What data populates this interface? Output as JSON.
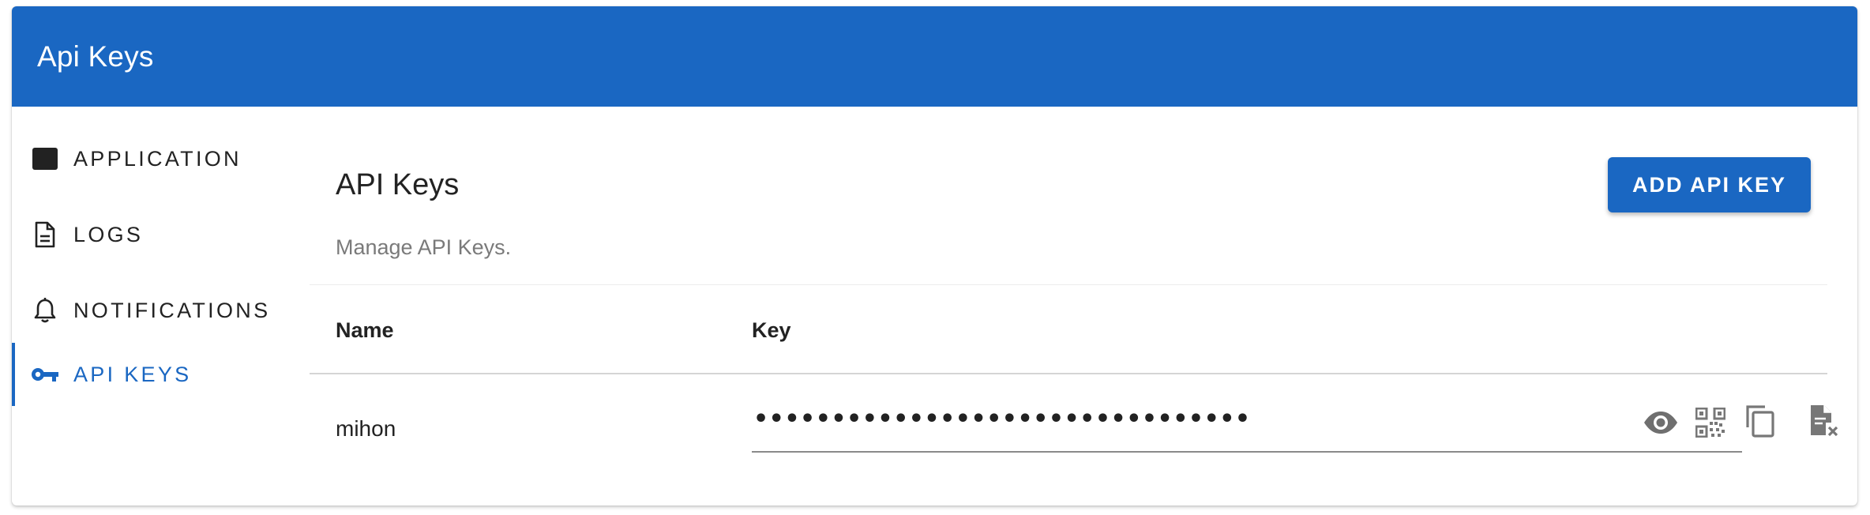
{
  "app": {
    "title": "Api Keys",
    "accent": "#1a67c2"
  },
  "sidebar": {
    "items": [
      {
        "label": "APPLICATION",
        "icon": "application-icon",
        "active": false
      },
      {
        "label": "LOGS",
        "icon": "document-icon",
        "active": false
      },
      {
        "label": "NOTIFICATIONS",
        "icon": "bell-icon",
        "active": false
      },
      {
        "label": "API KEYS",
        "icon": "key-icon",
        "active": true
      }
    ]
  },
  "main": {
    "title": "API Keys",
    "subtitle": "Manage API Keys.",
    "add_button_label": "ADD API KEY",
    "table": {
      "headers": {
        "name": "Name",
        "key": "Key"
      },
      "rows": [
        {
          "name": "mihon",
          "key_masked": "••••••••••••••••••••••••••••••••",
          "actions": [
            "eye-icon",
            "qr-code-icon",
            "copy-icon",
            "delete-file-icon"
          ]
        }
      ]
    }
  }
}
